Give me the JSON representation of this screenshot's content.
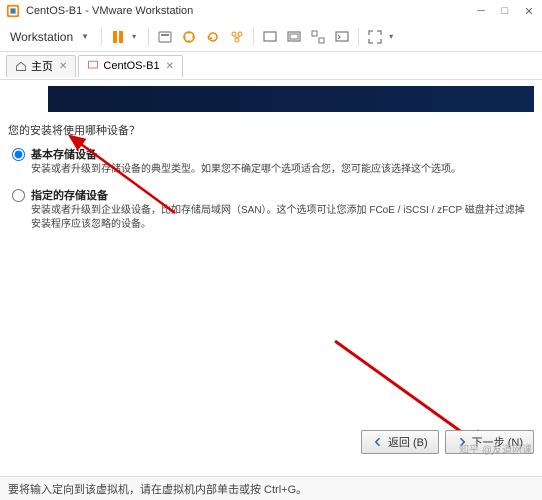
{
  "window": {
    "title": "CentOS-B1 - VMware Workstation"
  },
  "menu": {
    "workstation": "Workstation"
  },
  "tabs": {
    "home": "主页",
    "vm": "CentOS-B1"
  },
  "installer": {
    "prompt": "您的安装将使用哪种设备？",
    "option1": {
      "title": "基本存储设备",
      "desc": "安装或者升级到存储设备的典型类型。如果您不确定哪个选项适合您，您可能应该选择这个选项。"
    },
    "option2": {
      "title": "指定的存储设备",
      "desc": "安装或者升级到企业级设备，比如存储局域网（SAN）。这个选项可让您添加 FCoE / iSCSI / zFCP 磁盘并过滤掉安装程序应该忽略的设备。"
    }
  },
  "buttons": {
    "back": "返回 (B)",
    "next": "下一步 (N)"
  },
  "status": {
    "hint": "要将输入定向到该虚拟机，请在虚拟机内部单击或按 Ctrl+G。"
  },
  "watermark": "知乎 @友道网课"
}
